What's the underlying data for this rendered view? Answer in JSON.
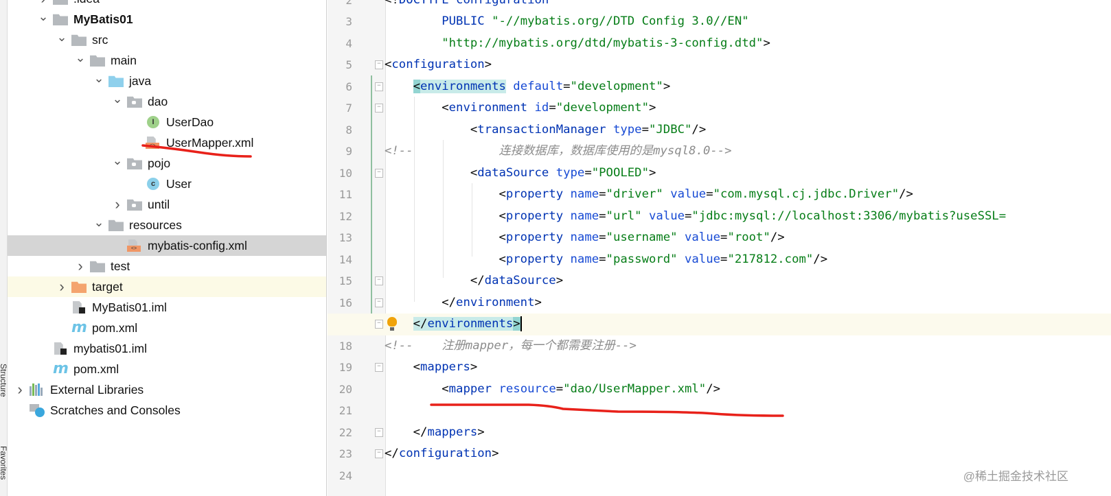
{
  "side_strip": {
    "labels": [
      "Structure",
      "Favorites"
    ]
  },
  "project_tree": [
    {
      "label": ".idea",
      "depth": 0,
      "icon": "folder",
      "chevron": "right",
      "partial": true
    },
    {
      "label": "MyBatis01",
      "depth": 0,
      "icon": "module-folder",
      "chevron": "down",
      "bold": true
    },
    {
      "label": "src",
      "depth": 1,
      "icon": "folder",
      "chevron": "down"
    },
    {
      "label": "main",
      "depth": 2,
      "icon": "folder",
      "chevron": "down"
    },
    {
      "label": "java",
      "depth": 3,
      "icon": "source-folder",
      "chevron": "down"
    },
    {
      "label": "dao",
      "depth": 4,
      "icon": "package",
      "chevron": "down"
    },
    {
      "label": "UserDao",
      "depth": 5,
      "icon": "interface"
    },
    {
      "label": "UserMapper.xml",
      "depth": 5,
      "icon": "xml-file"
    },
    {
      "label": "pojo",
      "depth": 4,
      "icon": "package",
      "chevron": "down"
    },
    {
      "label": "User",
      "depth": 5,
      "icon": "class"
    },
    {
      "label": "until",
      "depth": 4,
      "icon": "package",
      "chevron": "right"
    },
    {
      "label": "resources",
      "depth": 3,
      "icon": "resources-folder",
      "chevron": "down"
    },
    {
      "label": "mybatis-config.xml",
      "depth": 4,
      "icon": "xml-file",
      "selected": true
    },
    {
      "label": "test",
      "depth": 2,
      "icon": "folder",
      "chevron": "right"
    },
    {
      "label": "target",
      "depth": 1,
      "icon": "excluded-folder",
      "chevron": "right",
      "highlighted": true
    },
    {
      "label": "MyBatis01.iml",
      "depth": 1,
      "icon": "iml-file"
    },
    {
      "label": "pom.xml",
      "depth": 1,
      "icon": "maven-file"
    },
    {
      "label": "mybatis01.iml",
      "depth": 0,
      "icon": "iml-file"
    },
    {
      "label": "pom.xml",
      "depth": 0,
      "icon": "maven-file"
    },
    {
      "label": "External Libraries",
      "depth": -1,
      "icon": "libraries",
      "chevron": "right"
    },
    {
      "label": "Scratches and Consoles",
      "depth": -1,
      "icon": "scratches"
    }
  ],
  "editor": {
    "current_line": 17,
    "lines": [
      {
        "n": 2,
        "tokens": [
          {
            "c": "b",
            "t": "<!"
          },
          {
            "c": "t",
            "t": "DOCTYPE configuration"
          }
        ]
      },
      {
        "n": 3,
        "tokens": [
          {
            "c": "b",
            "t": "        "
          },
          {
            "c": "t",
            "t": "PUBLIC "
          },
          {
            "c": "v",
            "t": "\"-//mybatis.org//DTD Config 3.0//EN\""
          }
        ]
      },
      {
        "n": 4,
        "tokens": [
          {
            "c": "b",
            "t": "        "
          },
          {
            "c": "v",
            "t": "\"http://mybatis.org/dtd/mybatis-3-config.dtd\""
          },
          {
            "c": "b",
            "t": ">"
          }
        ]
      },
      {
        "n": 5,
        "fold": true,
        "tokens": [
          {
            "c": "b",
            "t": "<"
          },
          {
            "c": "t",
            "t": "configuration"
          },
          {
            "c": "b",
            "t": ">"
          }
        ]
      },
      {
        "n": 6,
        "fold": true,
        "tokens": [
          {
            "c": "b",
            "t": "    "
          },
          {
            "c": "b",
            "t": "<",
            "m": 2
          },
          {
            "c": "t",
            "t": "environments",
            "m": 1
          },
          {
            "c": "b",
            "t": " "
          },
          {
            "c": "a",
            "t": "default"
          },
          {
            "c": "b",
            "t": "="
          },
          {
            "c": "v",
            "t": "\"development\""
          },
          {
            "c": "b",
            "t": ">"
          }
        ]
      },
      {
        "n": 7,
        "fold": true,
        "tokens": [
          {
            "c": "b",
            "t": "        <"
          },
          {
            "c": "t",
            "t": "environment"
          },
          {
            "c": "b",
            "t": " "
          },
          {
            "c": "a",
            "t": "id"
          },
          {
            "c": "b",
            "t": "="
          },
          {
            "c": "v",
            "t": "\"development\""
          },
          {
            "c": "b",
            "t": ">"
          }
        ]
      },
      {
        "n": 8,
        "tokens": [
          {
            "c": "b",
            "t": "            <"
          },
          {
            "c": "t",
            "t": "transactionManager"
          },
          {
            "c": "b",
            "t": " "
          },
          {
            "c": "a",
            "t": "type"
          },
          {
            "c": "b",
            "t": "="
          },
          {
            "c": "v",
            "t": "\"JDBC\""
          },
          {
            "c": "b",
            "t": "/>"
          }
        ]
      },
      {
        "n": 9,
        "tokens": [
          {
            "c": "c",
            "t": "<!--            连接数据库，数据库使用的是mysql8.0-->"
          }
        ]
      },
      {
        "n": 10,
        "fold": true,
        "tokens": [
          {
            "c": "b",
            "t": "            <"
          },
          {
            "c": "t",
            "t": "dataSource"
          },
          {
            "c": "b",
            "t": " "
          },
          {
            "c": "a",
            "t": "type"
          },
          {
            "c": "b",
            "t": "="
          },
          {
            "c": "v",
            "t": "\"POOLED\""
          },
          {
            "c": "b",
            "t": ">"
          }
        ]
      },
      {
        "n": 11,
        "tokens": [
          {
            "c": "b",
            "t": "                <"
          },
          {
            "c": "t",
            "t": "property"
          },
          {
            "c": "b",
            "t": " "
          },
          {
            "c": "a",
            "t": "name"
          },
          {
            "c": "b",
            "t": "="
          },
          {
            "c": "v",
            "t": "\"driver\""
          },
          {
            "c": "b",
            "t": " "
          },
          {
            "c": "a",
            "t": "value"
          },
          {
            "c": "b",
            "t": "="
          },
          {
            "c": "v",
            "t": "\"com.mysql.cj.jdbc.Driver\""
          },
          {
            "c": "b",
            "t": "/>"
          }
        ]
      },
      {
        "n": 12,
        "tokens": [
          {
            "c": "b",
            "t": "                <"
          },
          {
            "c": "t",
            "t": "property"
          },
          {
            "c": "b",
            "t": " "
          },
          {
            "c": "a",
            "t": "name"
          },
          {
            "c": "b",
            "t": "="
          },
          {
            "c": "v",
            "t": "\"url\""
          },
          {
            "c": "b",
            "t": " "
          },
          {
            "c": "a",
            "t": "value"
          },
          {
            "c": "b",
            "t": "="
          },
          {
            "c": "v",
            "t": "\"jdbc:mysql://localhost:3306/mybatis?useSSL="
          }
        ]
      },
      {
        "n": 13,
        "tokens": [
          {
            "c": "b",
            "t": "                <"
          },
          {
            "c": "t",
            "t": "property"
          },
          {
            "c": "b",
            "t": " "
          },
          {
            "c": "a",
            "t": "name"
          },
          {
            "c": "b",
            "t": "="
          },
          {
            "c": "v",
            "t": "\"username\""
          },
          {
            "c": "b",
            "t": " "
          },
          {
            "c": "a",
            "t": "value"
          },
          {
            "c": "b",
            "t": "="
          },
          {
            "c": "v",
            "t": "\"root\""
          },
          {
            "c": "b",
            "t": "/>"
          }
        ]
      },
      {
        "n": 14,
        "tokens": [
          {
            "c": "b",
            "t": "                <"
          },
          {
            "c": "t",
            "t": "property"
          },
          {
            "c": "b",
            "t": " "
          },
          {
            "c": "a",
            "t": "name"
          },
          {
            "c": "b",
            "t": "="
          },
          {
            "c": "v",
            "t": "\"password\""
          },
          {
            "c": "b",
            "t": " "
          },
          {
            "c": "a",
            "t": "value"
          },
          {
            "c": "b",
            "t": "="
          },
          {
            "c": "v",
            "t": "\"217812.com\""
          },
          {
            "c": "b",
            "t": "/>"
          }
        ]
      },
      {
        "n": 15,
        "fold": true,
        "tokens": [
          {
            "c": "b",
            "t": "            </"
          },
          {
            "c": "t",
            "t": "dataSource"
          },
          {
            "c": "b",
            "t": ">"
          }
        ]
      },
      {
        "n": 16,
        "fold": true,
        "tokens": [
          {
            "c": "b",
            "t": "        </"
          },
          {
            "c": "t",
            "t": "environment"
          },
          {
            "c": "b",
            "t": ">"
          }
        ]
      },
      {
        "n": 17,
        "fold": true,
        "bulb": true,
        "tokens": [
          {
            "c": "b",
            "t": "    "
          },
          {
            "c": "b",
            "t": "</",
            "m": 1
          },
          {
            "c": "t",
            "t": "environments",
            "m": 1
          },
          {
            "c": "b",
            "t": ">",
            "m": 2
          }
        ]
      },
      {
        "n": 18,
        "tokens": [
          {
            "c": "c",
            "t": "<!--    注册mapper，每一个都需要注册-->"
          }
        ]
      },
      {
        "n": 19,
        "fold": true,
        "tokens": [
          {
            "c": "b",
            "t": "    <"
          },
          {
            "c": "t",
            "t": "mappers"
          },
          {
            "c": "b",
            "t": ">"
          }
        ]
      },
      {
        "n": 20,
        "tokens": [
          {
            "c": "b",
            "t": "        <"
          },
          {
            "c": "t",
            "t": "mapper"
          },
          {
            "c": "b",
            "t": " "
          },
          {
            "c": "a",
            "t": "resource"
          },
          {
            "c": "b",
            "t": "="
          },
          {
            "c": "v",
            "t": "\"dao/UserMapper.xml\""
          },
          {
            "c": "b",
            "t": "/>"
          }
        ]
      },
      {
        "n": 21,
        "tokens": []
      },
      {
        "n": 22,
        "fold": true,
        "tokens": [
          {
            "c": "b",
            "t": "    </"
          },
          {
            "c": "t",
            "t": "mappers"
          },
          {
            "c": "b",
            "t": ">"
          }
        ]
      },
      {
        "n": 23,
        "fold": true,
        "tokens": [
          {
            "c": "b",
            "t": "</"
          },
          {
            "c": "t",
            "t": "configuration"
          },
          {
            "c": "b",
            "t": ">"
          }
        ]
      },
      {
        "n": 24,
        "tokens": []
      }
    ]
  },
  "annotation_color": "#e8211a",
  "watermark": "@稀土掘金技术社区"
}
